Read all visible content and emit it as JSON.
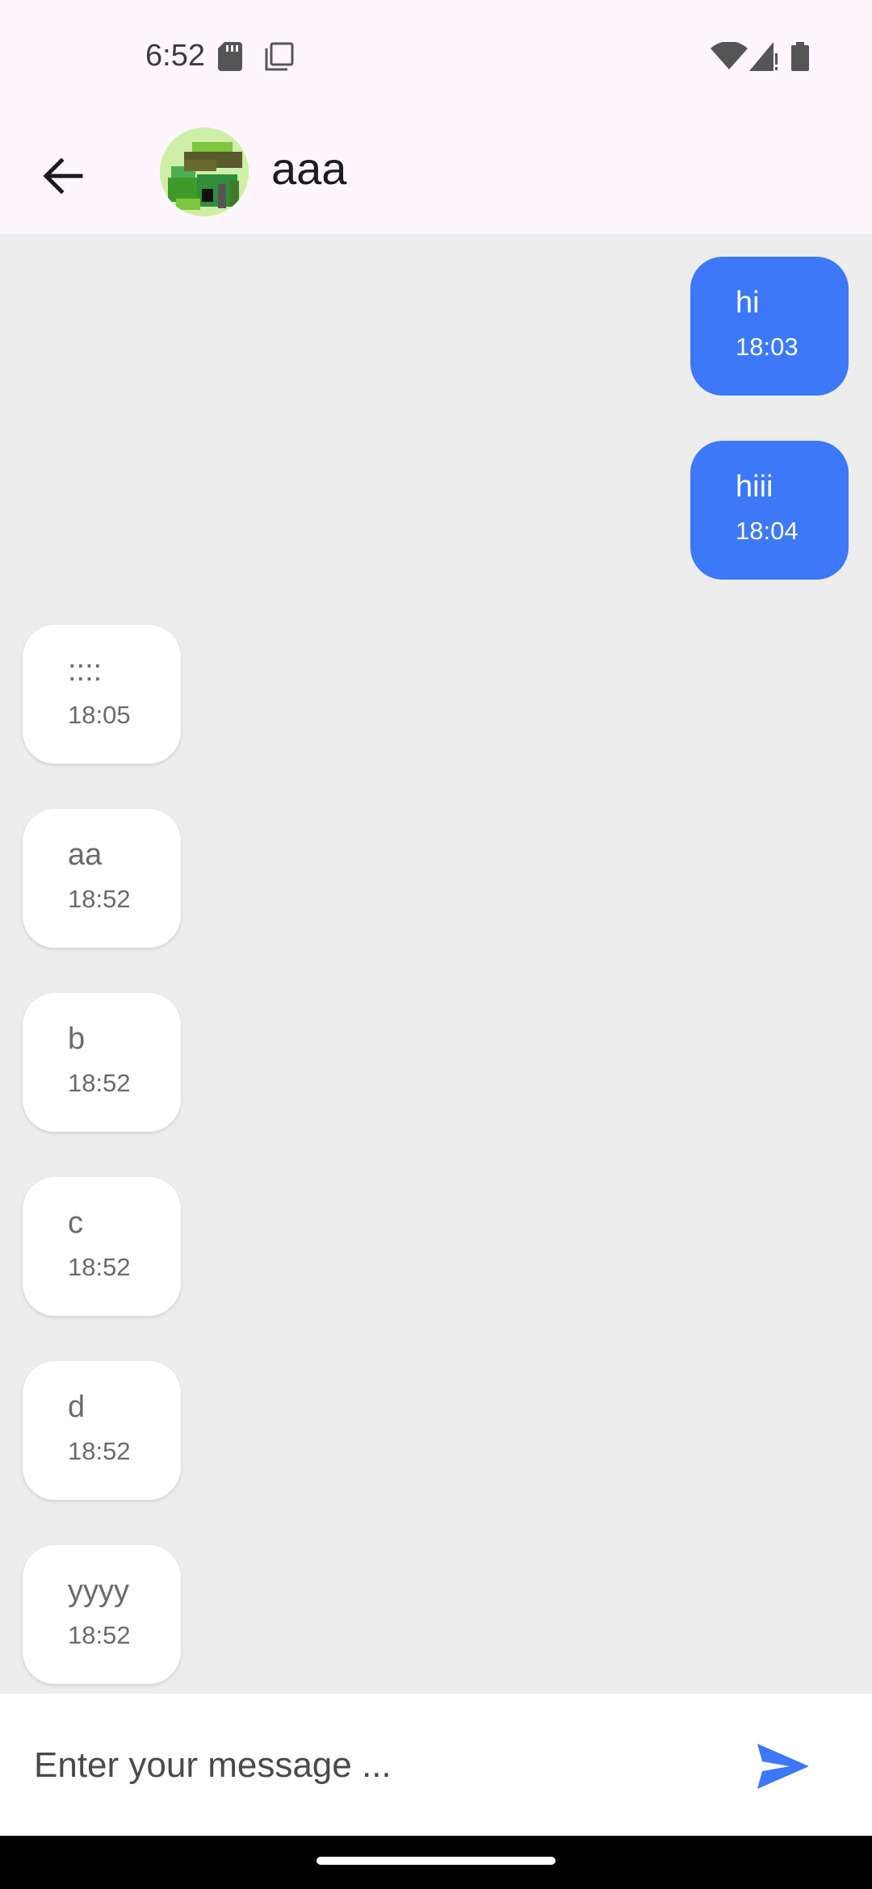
{
  "status_bar": {
    "time": "6:52"
  },
  "header": {
    "contact_name": "aaa"
  },
  "messages": [
    {
      "text": "hi",
      "time": "18:03",
      "direction": "outgoing"
    },
    {
      "text": "hiii",
      "time": "18:04",
      "direction": "outgoing"
    },
    {
      "text": "::::",
      "time": "18:05",
      "direction": "incoming"
    },
    {
      "text": "aa",
      "time": "18:52",
      "direction": "incoming"
    },
    {
      "text": "b",
      "time": "18:52",
      "direction": "incoming"
    },
    {
      "text": "c",
      "time": "18:52",
      "direction": "incoming"
    },
    {
      "text": "d",
      "time": "18:52",
      "direction": "incoming"
    },
    {
      "text": "yyyy",
      "time": "18:52",
      "direction": "incoming"
    }
  ],
  "composer": {
    "placeholder": "Enter your message ..."
  },
  "colors": {
    "outgoing_bubble": "#3c78f7",
    "incoming_bubble": "#ffffff",
    "background": "#ededed",
    "send_icon": "#3c78f7"
  },
  "icons": [
    "sd-card-icon",
    "copy-icon",
    "wifi-icon",
    "signal-icon",
    "battery-icon",
    "back-arrow-icon",
    "send-icon"
  ]
}
